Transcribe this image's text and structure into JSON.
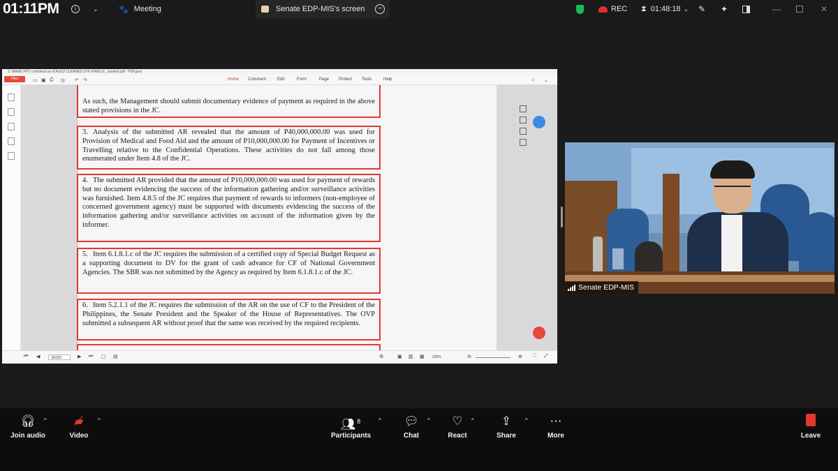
{
  "top_bar": {
    "clock": "01:11PM",
    "info_icon": "info-icon",
    "tabs": [
      {
        "label": "Meeting",
        "icon": "paw-icon"
      },
      {
        "label": "Senate EDP-MIS's screen",
        "icon": "screen-share-icon"
      }
    ],
    "rec_label": "REC",
    "timer": "01:48:18",
    "shield_color": "#1db954",
    "rec_color": "#e02d2d"
  },
  "pdf": {
    "file_title": "3. WAME PPT combined as of AUG2 CLEANED LPK FINALv2 _marked.pdf - PDFgear",
    "files_button": "Files",
    "menu": [
      "Home",
      "Comment",
      "Edit",
      "Form",
      "Page",
      "Protect",
      "Tools",
      "Help"
    ],
    "paragraphs": [
      {
        "num": "",
        "text": "As such, the Management should submit documentary evidence of payment as required in the above stated provisions in the JC."
      },
      {
        "num": "3.",
        "text": "Analysis of the submitted AR revealed that the amount of P40,000,000.00 was used for Provision of Medical and Food Aid and the amount of P10,000,000.00 for Payment of Incentives or Travelling relative to the Confidential Operations. These activities do not fall among those enumerated under Item 4.8 of the JC."
      },
      {
        "num": "4.",
        "text": "The submitted AR provided that the amount of P10,000,000.00 was used for payment of rewards but no document evidencing the success of the information gathering and/or surveillance activities was furnished. Item 4.8.5 of the JC requires that payment of rewards to informers (non-employee of concerned government agency) must be supported with documents evidencing the success of the information gathering and/or surveillance activities on account of the information given by the informer."
      },
      {
        "num": "5.",
        "text": "Item 6.1.8.1.c of the JC requires the submission of a certified copy of Special Budget Request as a supporting document to DV for the grant of cash advance for CF of National Government Agencies. The SBR was not submitted by the Agency as required by Item 6.1.8.1.c of the JC."
      },
      {
        "num": "6.",
        "text": "Item 5.2.1.1 of the JC requires the submission of the AR on the use of CF to the President of the Philippines, the Senate President and the Speaker of the House of Representatives. The OVP submitted a subsequent AR without proof that the same was received by the required recipients."
      }
    ],
    "page_indicator": "36/262",
    "zoom": "200%",
    "accent": "#e0392f"
  },
  "video": {
    "participant_name": "Senate EDP-MIS"
  },
  "toolbar": {
    "join_audio": "Join audio",
    "video": "Video",
    "participants": "Participants",
    "participants_count": "8",
    "chat": "Chat",
    "react": "React",
    "share": "Share",
    "more": "More",
    "leave": "Leave",
    "leave_color": "#e0392f"
  }
}
